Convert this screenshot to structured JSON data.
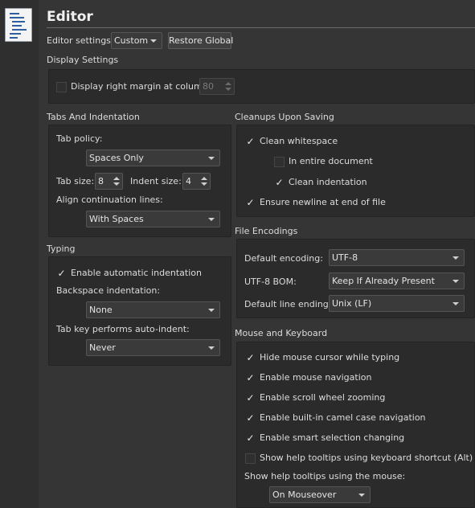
{
  "header": {
    "title": "Editor"
  },
  "editor_settings": {
    "label": "Editor settings:",
    "value": "Custom",
    "restore_button": "Restore Global"
  },
  "display": {
    "title": "Display Settings",
    "right_margin_label": "Display right margin at column:",
    "right_margin_checked": false,
    "right_margin_value": "80"
  },
  "tabs": {
    "title": "Tabs And Indentation",
    "policy_label": "Tab policy:",
    "policy_value": "Spaces Only",
    "tab_size_label": "Tab size:",
    "tab_size_value": "8",
    "indent_size_label": "Indent size:",
    "indent_size_value": "4",
    "align_label": "Align continuation lines:",
    "align_value": "With Spaces"
  },
  "typing": {
    "title": "Typing",
    "auto_indent_label": "Enable automatic indentation",
    "auto_indent_checked": true,
    "backspace_label": "Backspace indentation:",
    "backspace_value": "None",
    "tab_key_label": "Tab key performs auto-indent:",
    "tab_key_value": "Never"
  },
  "cleanups": {
    "title": "Cleanups Upon Saving",
    "clean_whitespace": {
      "label": "Clean whitespace",
      "checked": true
    },
    "entire_document": {
      "label": "In entire document",
      "checked": false
    },
    "clean_indentation": {
      "label": "Clean indentation",
      "checked": true
    },
    "ensure_newline": {
      "label": "Ensure newline at end of file",
      "checked": true
    }
  },
  "encodings": {
    "title": "File Encodings",
    "default_encoding_label": "Default encoding:",
    "default_encoding_value": "UTF-8",
    "bom_label": "UTF-8 BOM:",
    "bom_value": "Keep If Already Present",
    "line_endings_label": "Default line endings:",
    "line_endings_value": "Unix (LF)"
  },
  "mouse": {
    "title": "Mouse and Keyboard",
    "hide_cursor": {
      "label": "Hide mouse cursor while typing",
      "checked": true
    },
    "mouse_nav": {
      "label": "Enable mouse navigation",
      "checked": true
    },
    "scroll_zoom": {
      "label": "Enable scroll wheel zooming",
      "checked": true
    },
    "camel_case": {
      "label": "Enable built-in camel case navigation",
      "checked": true
    },
    "smart_selection": {
      "label": "Enable smart selection changing",
      "checked": true
    },
    "help_keyboard": {
      "label": "Show help tooltips using keyboard shortcut (Alt)",
      "checked": false
    },
    "help_mouse_label": "Show help tooltips using the mouse:",
    "help_mouse_value": "On Mouseover"
  },
  "colors": {
    "background": "#353535",
    "panel": "#2b2b2b",
    "text": "#dcdcdc",
    "icon_lines": "#2f5f9f"
  }
}
